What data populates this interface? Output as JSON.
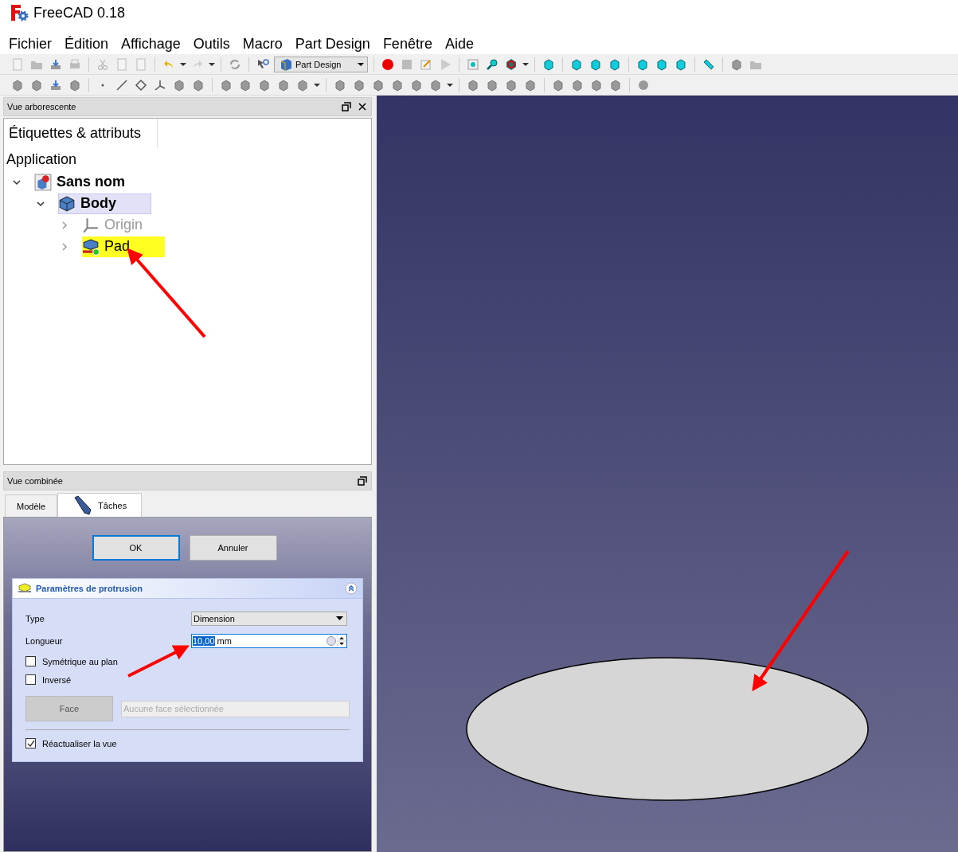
{
  "window": {
    "title": "FreeCAD 0.18"
  },
  "menu": [
    "Fichier",
    "Édition",
    "Affichage",
    "Outils",
    "Macro",
    "Part Design",
    "Fenêtre",
    "Aide"
  ],
  "toolbar": {
    "workbench": "Part Design"
  },
  "tree_panel": {
    "title": "Vue arborescente",
    "column_header": "Étiquettes & attributs",
    "root": "Application",
    "items": [
      {
        "label": "Sans nom",
        "kind": "document",
        "bold": true,
        "expanded": true,
        "selected": false,
        "highlighted": false,
        "dimmed": false,
        "children": [
          {
            "label": "Body",
            "kind": "body",
            "bold": true,
            "expanded": true,
            "selected": true,
            "highlighted": false,
            "dimmed": false,
            "children": [
              {
                "label": "Origin",
                "kind": "origin",
                "bold": false,
                "expanded": false,
                "selected": false,
                "highlighted": false,
                "dimmed": true
              },
              {
                "label": "Pad",
                "kind": "pad",
                "bold": false,
                "expanded": false,
                "selected": false,
                "highlighted": true,
                "dimmed": false
              }
            ]
          }
        ]
      }
    ]
  },
  "combo_panel": {
    "title": "Vue combinée",
    "tabs": [
      {
        "label": "Modèle",
        "selected": false
      },
      {
        "label": "Tâches",
        "selected": true
      }
    ],
    "buttons": [
      {
        "label": "OK",
        "default": true
      },
      {
        "label": "Annuler",
        "default": false
      }
    ],
    "section": {
      "title": "Paramètres de protrusion",
      "type_label": "Type",
      "type_value": "Dimension",
      "length_label": "Longueur",
      "length_value": "10,00",
      "length_unit": "mm",
      "checkboxes": [
        {
          "label": "Symétrique au plan",
          "checked": false
        },
        {
          "label": "Inversé",
          "checked": false
        }
      ],
      "face_button": {
        "label": "Face",
        "disabled": true
      },
      "face_field": {
        "value": "Aucune face sélectionnée",
        "disabled": true
      },
      "refresh": {
        "label": "Réactualiser la vue",
        "checked": true
      }
    }
  }
}
